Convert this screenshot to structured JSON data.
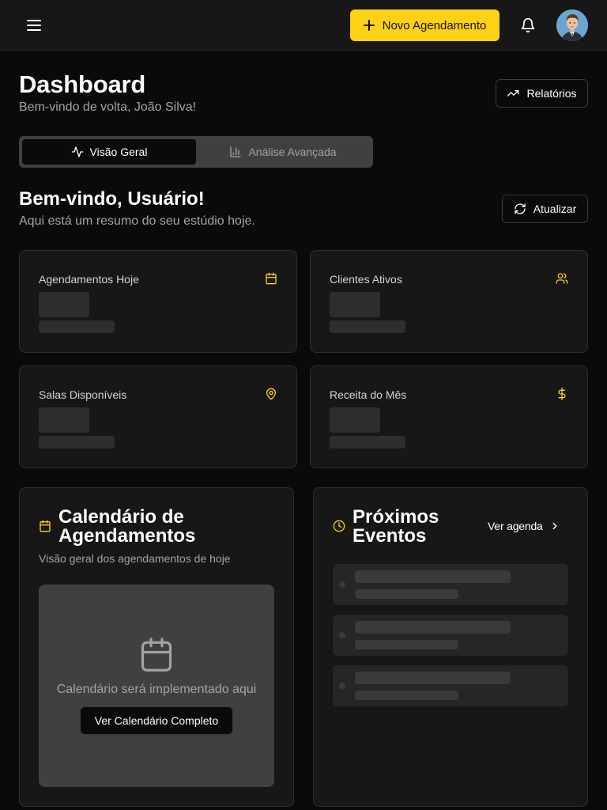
{
  "colors": {
    "accent": "#fcd116",
    "background": "#0a0a0a",
    "card": "#171717",
    "muted_text": "#a3a3a3"
  },
  "topbar": {
    "menu_icon": "menu-icon",
    "new_appointment_label": "Novo Agendamento",
    "bell_icon": "bell-icon",
    "avatar_icon": "user-avatar"
  },
  "header": {
    "title": "Dashboard",
    "subtitle": "Bem-vindo de volta, João Silva!",
    "reports_label": "Relatórios"
  },
  "tabs": [
    {
      "label": "Visão Geral",
      "icon": "activity-icon",
      "active": true
    },
    {
      "label": "Análise Avançada",
      "icon": "bar-chart-icon",
      "active": false
    }
  ],
  "welcome": {
    "title": "Bem-vindo, Usuário!",
    "subtitle": "Aqui está um resumo do seu estúdio hoje.",
    "refresh_label": "Atualizar"
  },
  "stats": [
    {
      "label": "Agendamentos Hoje",
      "icon": "calendar-icon"
    },
    {
      "label": "Clientes Ativos",
      "icon": "users-icon"
    },
    {
      "label": "Salas Disponíveis",
      "icon": "map-pin-icon"
    },
    {
      "label": "Receita do Mês",
      "icon": "dollar-icon"
    }
  ],
  "calendar_panel": {
    "title_line1": "Calendário de",
    "title_line2": "Agendamentos",
    "description": "Visão geral dos agendamentos de hoje",
    "placeholder": "Calendário será implementado aqui",
    "button_label": "Ver Calendário Completo"
  },
  "events_panel": {
    "title_line1": "Próximos",
    "title_line2": "Eventos",
    "link_label": "Ver agenda"
  }
}
